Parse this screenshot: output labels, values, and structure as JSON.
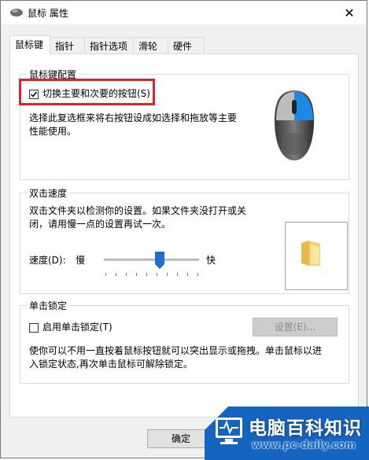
{
  "window": {
    "title": "鼠标 属性",
    "close_symbol": "✕"
  },
  "tabs": [
    {
      "label": "鼠标键",
      "active": true
    },
    {
      "label": "指针"
    },
    {
      "label": "指针选项"
    },
    {
      "label": "滑轮"
    },
    {
      "label": "硬件"
    }
  ],
  "button_config": {
    "group_title": "鼠标键配置",
    "swap_label": "切换主要和次要的按钮(S)",
    "swap_checked": true,
    "description_line1": "选择此复选框来将右按钮设成如选择和拖放等主要",
    "description_line2": "性能使用。"
  },
  "double_click": {
    "group_title": "双击速度",
    "description_line1": "双击文件夹以检测你的设置。如果文件夹没打开或关",
    "description_line2": "闭，请用慢一点的设置再试一次。",
    "speed_label": "速度(D):",
    "slow_label": "慢",
    "fast_label": "快",
    "speed_value": 0.6
  },
  "click_lock": {
    "group_title": "单击锁定",
    "enable_label": "启用单击锁定(T)",
    "enable_checked": false,
    "settings_button": "设置(E)...",
    "description_line1": "使你可以不用一直按着鼠标按钮就可以突出显示或拖拽。单击鼠标以进",
    "description_line2": "入锁定状态,再次单击鼠标可解除锁定。"
  },
  "footer": {
    "ok_button": "确定"
  },
  "watermark": {
    "title": "电脑百科知识",
    "url": "www.pc-daily.com"
  },
  "colors": {
    "highlight_box": "#d8262c",
    "mouse_accent": "#1e88e5",
    "watermark_bg": "#1565c0"
  }
}
